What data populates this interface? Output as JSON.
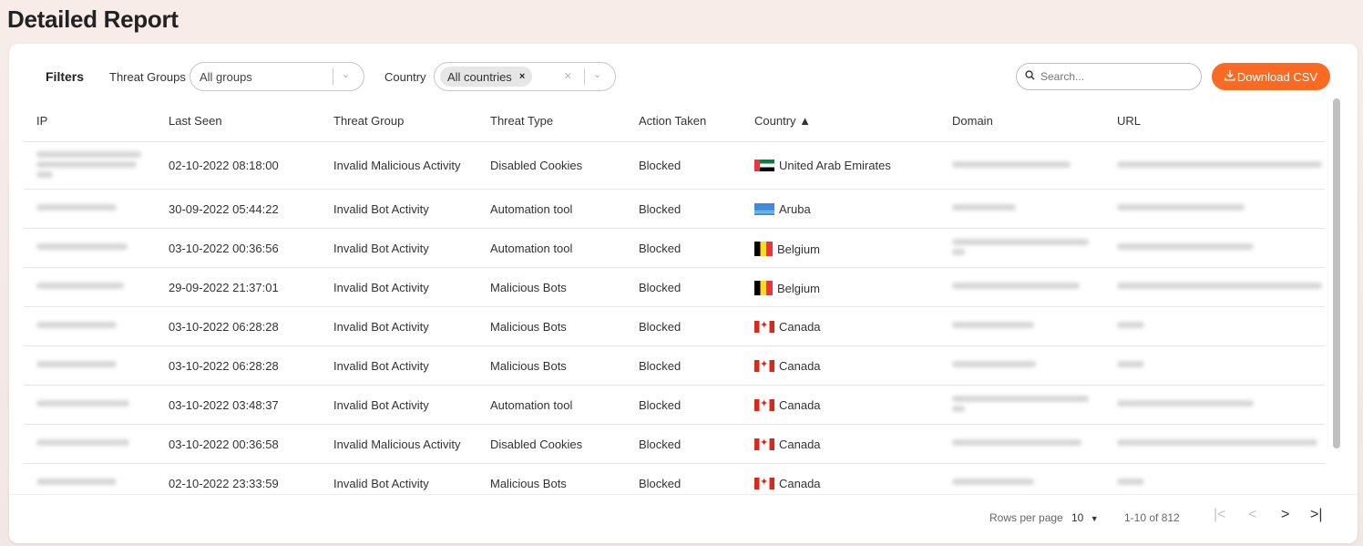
{
  "page": {
    "title": "Detailed Report"
  },
  "filters": {
    "label": "Filters",
    "threat_groups": {
      "label": "Threat Groups",
      "value": "All groups"
    },
    "country": {
      "label": "Country",
      "chip": "All countries",
      "chip_remove": "×"
    },
    "clear_icon": "×",
    "chevron_icon": "⌄"
  },
  "search": {
    "placeholder": "Search...",
    "icon": "🔍"
  },
  "download": {
    "label": "Download CSV",
    "icon": "⭳"
  },
  "table": {
    "columns": [
      "IP",
      "Last Seen",
      "Threat Group",
      "Threat Type",
      "Action Taken",
      "Country ▲",
      "Domain",
      "URL"
    ],
    "sort": {
      "column": "Country",
      "direction": "asc"
    },
    "rows": [
      {
        "last_seen": "02-10-2022 08:18:00",
        "threat_group": "Invalid Malicious Activity",
        "threat_type": "Disabled Cookies",
        "action": "Blocked",
        "country": "United Arab Emirates",
        "flag": "flag-ae"
      },
      {
        "last_seen": "30-09-2022 05:44:22",
        "threat_group": "Invalid Bot Activity",
        "threat_type": "Automation tool",
        "action": "Blocked",
        "country": "Aruba",
        "flag": "flag-aw"
      },
      {
        "last_seen": "03-10-2022 00:36:56",
        "threat_group": "Invalid Bot Activity",
        "threat_type": "Automation tool",
        "action": "Blocked",
        "country": "Belgium",
        "flag": "flag-be"
      },
      {
        "last_seen": "29-09-2022 21:37:01",
        "threat_group": "Invalid Bot Activity",
        "threat_type": "Malicious Bots",
        "action": "Blocked",
        "country": "Belgium",
        "flag": "flag-be"
      },
      {
        "last_seen": "03-10-2022 06:28:28",
        "threat_group": "Invalid Bot Activity",
        "threat_type": "Malicious Bots",
        "action": "Blocked",
        "country": "Canada",
        "flag": "flag-ca"
      },
      {
        "last_seen": "03-10-2022 06:28:28",
        "threat_group": "Invalid Bot Activity",
        "threat_type": "Malicious Bots",
        "action": "Blocked",
        "country": "Canada",
        "flag": "flag-ca"
      },
      {
        "last_seen": "03-10-2022 03:48:37",
        "threat_group": "Invalid Bot Activity",
        "threat_type": "Automation tool",
        "action": "Blocked",
        "country": "Canada",
        "flag": "flag-ca"
      },
      {
        "last_seen": "03-10-2022 00:36:58",
        "threat_group": "Invalid Malicious Activity",
        "threat_type": "Disabled Cookies",
        "action": "Blocked",
        "country": "Canada",
        "flag": "flag-ca"
      },
      {
        "last_seen": "02-10-2022 23:33:59",
        "threat_group": "Invalid Bot Activity",
        "threat_type": "Malicious Bots",
        "action": "Blocked",
        "country": "Canada",
        "flag": "flag-ca"
      }
    ]
  },
  "pagination": {
    "rows_per_page_label": "Rows per page",
    "rows_per_page": "10",
    "dropdown_icon": "▼",
    "range": "1-10 of 812",
    "first_icon": "|<",
    "prev_icon": "<",
    "next_icon": ">",
    "last_icon": ">|"
  },
  "colors": {
    "accent": "#fa6a22",
    "background": "#f5e9e5"
  }
}
